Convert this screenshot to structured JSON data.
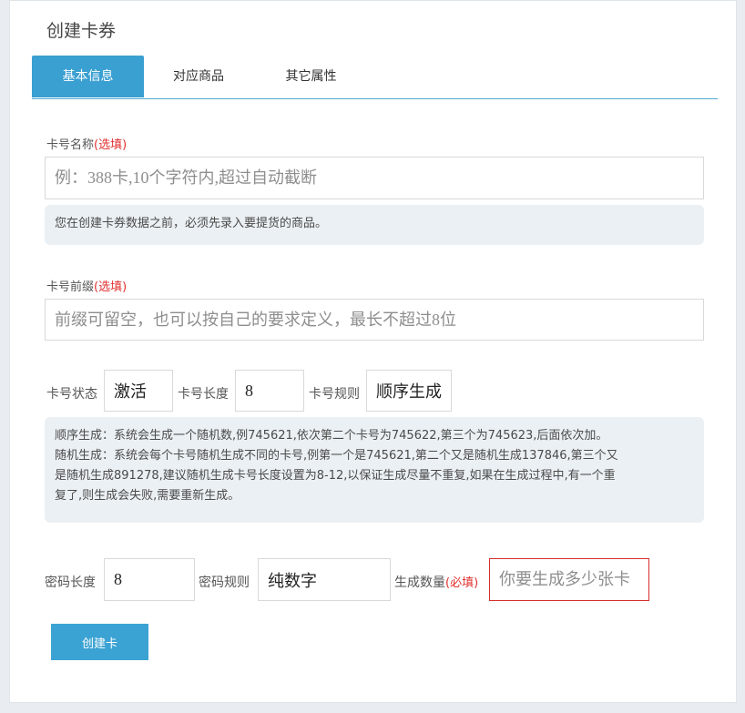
{
  "page": {
    "title": "创建卡券"
  },
  "tabs": [
    {
      "label": "基本信息",
      "active": true
    },
    {
      "label": "对应商品",
      "active": false
    },
    {
      "label": "其它属性",
      "active": false
    }
  ],
  "card_name": {
    "label": "卡号名称",
    "tag": "(选填)",
    "placeholder": "例：388卡,10个字符内,超过自动截断",
    "notice": "您在创建卡券数据之前，必须先录入要提货的商品。"
  },
  "card_prefix": {
    "label": "卡号前缀",
    "tag": "(选填)",
    "placeholder": "前缀可留空，也可以按自己的要求定义，最长不超过8位"
  },
  "card_settings": {
    "status_label": "卡号状态",
    "status_value": "激活",
    "length_label": "卡号长度",
    "length_value": "8",
    "rule_label": "卡号规则",
    "rule_value": "顺序生成"
  },
  "rules_notice": {
    "line1": "顺序生成：系统会生成一个随机数,例745621,依次第二个卡号为745622,第三个为745623,后面依次加。",
    "line2": "随机生成：系统会每个卡号随机生成不同的卡号,例第一个是745621,第二个又是随机生成137846,第三个又",
    "line3": "是随机生成891278,建议随机生成卡号长度设置为8-12,以保证生成尽量不重复,如果在生成过程中,有一个重",
    "line4": "复了,则生成会失败,需要重新生成。"
  },
  "password": {
    "length_label": "密码长度",
    "length_value": "8",
    "rule_label": "密码规则",
    "rule_value": "纯数字",
    "quantity_label": "生成数量",
    "quantity_tag": "(必填)",
    "quantity_placeholder": "你要生成多少张卡"
  },
  "actions": {
    "create_label": "创建卡"
  },
  "colors": {
    "accent": "#3a9fd1",
    "required": "#e12f2f",
    "notice_bg": "#ebf0f4"
  }
}
